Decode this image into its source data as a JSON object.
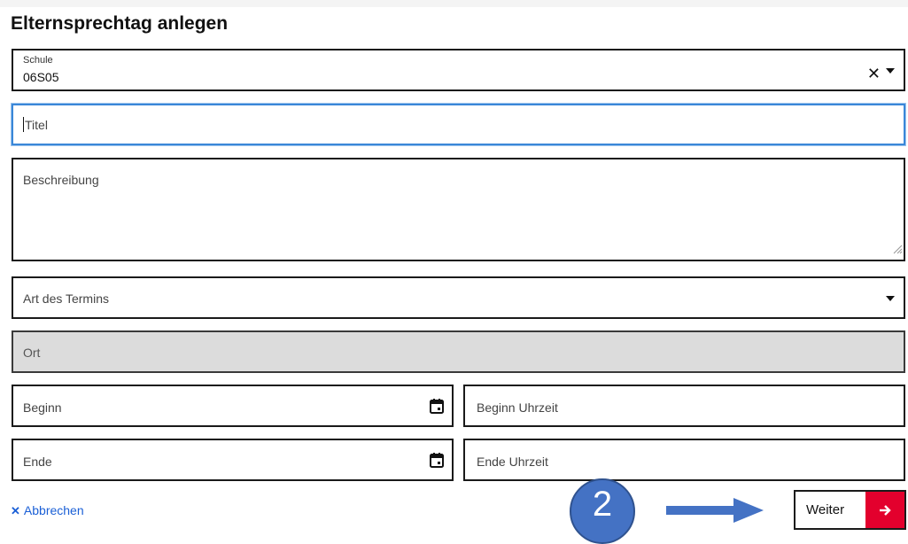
{
  "page": {
    "title": "Elternsprechtag anlegen"
  },
  "form": {
    "school": {
      "label": "Schule",
      "value": "06S05",
      "clear_icon": "close-icon",
      "toggle_icon": "chevron-down-icon"
    },
    "title_field": {
      "placeholder": "Titel"
    },
    "description_field": {
      "placeholder": "Beschreibung"
    },
    "type_select": {
      "placeholder": "Art des Termins"
    },
    "location_field": {
      "placeholder": "Ort"
    },
    "start_date": {
      "placeholder": "Beginn",
      "icon": "calendar-icon"
    },
    "start_time": {
      "placeholder": "Beginn Uhrzeit"
    },
    "end_date": {
      "placeholder": "Ende",
      "icon": "calendar-icon"
    },
    "end_time": {
      "placeholder": "Ende Uhrzeit"
    }
  },
  "footer": {
    "cancel_label": "Abbrechen",
    "cancel_icon": "close-icon",
    "next_label": "Weiter",
    "next_icon": "arrow-right-icon"
  },
  "annotation": {
    "step_number": "2",
    "arrow_icon": "arrow-right-icon"
  },
  "colors": {
    "accent": "#e3002d",
    "focus": "#3a87d8",
    "link": "#1a5fd6",
    "annotation": "#4472c4",
    "disabled_bg": "#dcdcdc"
  }
}
